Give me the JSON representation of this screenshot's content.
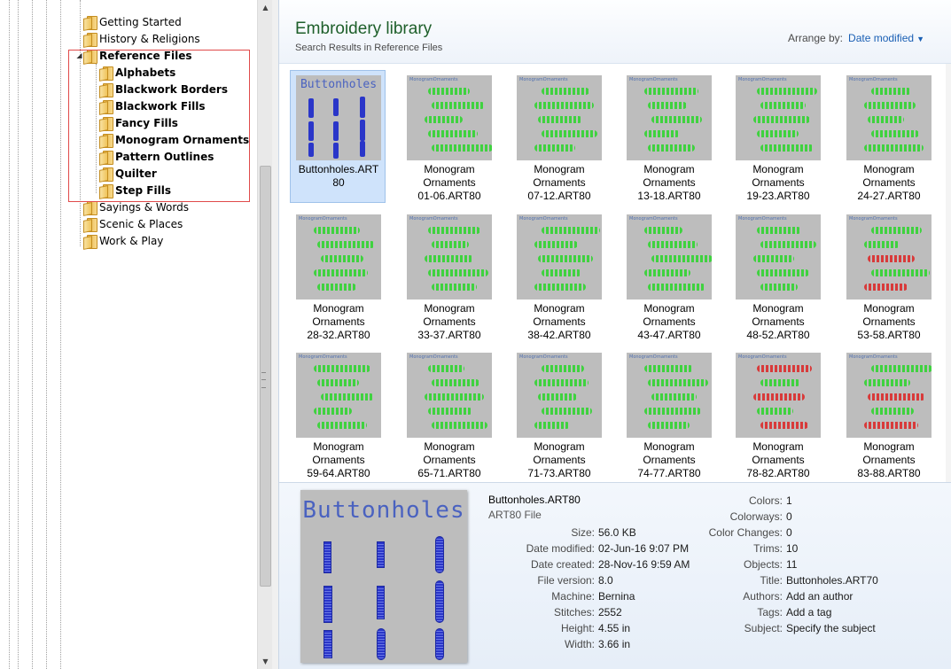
{
  "tree": {
    "items": [
      {
        "label": "Getting Started",
        "bold": false
      },
      {
        "label": "History & Religions",
        "bold": false
      },
      {
        "label": "Reference Files",
        "bold": true
      },
      {
        "label": "Alphabets",
        "bold": true
      },
      {
        "label": "Blackwork Borders",
        "bold": true
      },
      {
        "label": "Blackwork Fills",
        "bold": true
      },
      {
        "label": "Fancy Fills",
        "bold": true
      },
      {
        "label": "Monogram Ornaments",
        "bold": true
      },
      {
        "label": "Pattern Outlines",
        "bold": true
      },
      {
        "label": "Quilter",
        "bold": true
      },
      {
        "label": "Step Fills",
        "bold": true
      },
      {
        "label": "Sayings & Words",
        "bold": false
      },
      {
        "label": "Scenic & Places",
        "bold": false
      },
      {
        "label": "Work & Play",
        "bold": false
      }
    ]
  },
  "library": {
    "title": "Embroidery library",
    "subtitle": "Search Results in Reference Files",
    "arrange_label": "Arrange by:",
    "arrange_value": "Date modified"
  },
  "tiles": [
    {
      "caption_lines": [
        "Buttonholes.ART",
        "80"
      ],
      "selected": true,
      "thumb_title": "Buttonholes",
      "kind": "buttonholes"
    },
    {
      "caption_lines": [
        "Monogram",
        "Ornaments",
        "01-06.ART80"
      ],
      "selected": false,
      "thumb_title": "MonogramOrnaments",
      "kind": "ornament"
    },
    {
      "caption_lines": [
        "Monogram",
        "Ornaments",
        "07-12.ART80"
      ],
      "selected": false,
      "thumb_title": "MonogramOrnaments",
      "kind": "ornament"
    },
    {
      "caption_lines": [
        "Monogram",
        "Ornaments",
        "13-18.ART80"
      ],
      "selected": false,
      "thumb_title": "MonogramOrnaments",
      "kind": "ornament"
    },
    {
      "caption_lines": [
        "Monogram",
        "Ornaments",
        "19-23.ART80"
      ],
      "selected": false,
      "thumb_title": "MonogramOrnaments",
      "kind": "ornament"
    },
    {
      "caption_lines": [
        "Monogram",
        "Ornaments",
        "24-27.ART80"
      ],
      "selected": false,
      "thumb_title": "MonogramOrnaments",
      "kind": "ornament"
    },
    {
      "caption_lines": [
        "Monogram",
        "Ornaments",
        "28-32.ART80"
      ],
      "selected": false,
      "thumb_title": "MonogramOrnaments",
      "kind": "ornament"
    },
    {
      "caption_lines": [
        "Monogram",
        "Ornaments",
        "33-37.ART80"
      ],
      "selected": false,
      "thumb_title": "MonogramOrnaments",
      "kind": "ornament"
    },
    {
      "caption_lines": [
        "Monogram",
        "Ornaments",
        "38-42.ART80"
      ],
      "selected": false,
      "thumb_title": "MonogramOrnaments",
      "kind": "ornament"
    },
    {
      "caption_lines": [
        "Monogram",
        "Ornaments",
        "43-47.ART80"
      ],
      "selected": false,
      "thumb_title": "MonogramOrnaments",
      "kind": "ornament"
    },
    {
      "caption_lines": [
        "Monogram",
        "Ornaments",
        "48-52.ART80"
      ],
      "selected": false,
      "thumb_title": "MonogramOrnaments",
      "kind": "ornament"
    },
    {
      "caption_lines": [
        "Monogram",
        "Ornaments",
        "53-58.ART80"
      ],
      "selected": false,
      "thumb_title": "MonogramOrnaments",
      "kind": "ornament-multi"
    },
    {
      "caption_lines": [
        "Monogram",
        "Ornaments",
        "59-64.ART80"
      ],
      "selected": false,
      "thumb_title": "MonogramOrnaments",
      "kind": "ornament"
    },
    {
      "caption_lines": [
        "Monogram",
        "Ornaments",
        "65-71.ART80"
      ],
      "selected": false,
      "thumb_title": "MonogramOrnaments",
      "kind": "ornament"
    },
    {
      "caption_lines": [
        "Monogram",
        "Ornaments",
        "71-73.ART80"
      ],
      "selected": false,
      "thumb_title": "MonogramOrnaments",
      "kind": "ornament"
    },
    {
      "caption_lines": [
        "Monogram",
        "Ornaments",
        "74-77.ART80"
      ],
      "selected": false,
      "thumb_title": "MonogramOrnaments",
      "kind": "ornament"
    },
    {
      "caption_lines": [
        "Monogram",
        "Ornaments",
        "78-82.ART80"
      ],
      "selected": false,
      "thumb_title": "MonogramOrnaments",
      "kind": "ornament-red"
    },
    {
      "caption_lines": [
        "Monogram",
        "Ornaments",
        "83-88.ART80"
      ],
      "selected": false,
      "thumb_title": "MonogramOrnaments",
      "kind": "ornament-multi"
    }
  ],
  "details": {
    "preview_title": "Buttonholes",
    "name": "Buttonholes.ART80",
    "type": "ART80 File",
    "left": [
      {
        "k": "Size:",
        "v": "56.0 KB"
      },
      {
        "k": "Date modified:",
        "v": "02-Jun-16 9:07 PM"
      },
      {
        "k": "Date created:",
        "v": "28-Nov-16 9:59 AM"
      },
      {
        "k": "File version:",
        "v": "8.0"
      },
      {
        "k": "Machine:",
        "v": "Bernina"
      },
      {
        "k": "Stitches:",
        "v": "2552"
      },
      {
        "k": "Height:",
        "v": "4.55 in"
      },
      {
        "k": "Width:",
        "v": "3.66 in"
      }
    ],
    "right": [
      {
        "k": "Colors:",
        "v": "1"
      },
      {
        "k": "Colorways:",
        "v": "0"
      },
      {
        "k": "Color Changes:",
        "v": "0"
      },
      {
        "k": "Trims:",
        "v": "10"
      },
      {
        "k": "Objects:",
        "v": "11"
      },
      {
        "k": "Title:",
        "v": "Buttonholes.ART70"
      },
      {
        "k": "Authors:",
        "v": "Add an author"
      },
      {
        "k": "Tags:",
        "v": "Add a tag"
      },
      {
        "k": "Subject:",
        "v": "Specify the subject"
      }
    ]
  },
  "colors": {
    "title_green": "#1e5f2a",
    "link_blue": "#1a5fb4",
    "selection": "#cfe3fb",
    "thumb_gray": "#bdbdbd",
    "stitch_green": "#3fd23f",
    "stitch_red": "#d83a3a",
    "stitch_blue": "#2a36c9"
  },
  "icons": {
    "folder": "folder-icon",
    "expander": "collapse-triangle-icon",
    "dropdown": "chevron-down-icon"
  }
}
